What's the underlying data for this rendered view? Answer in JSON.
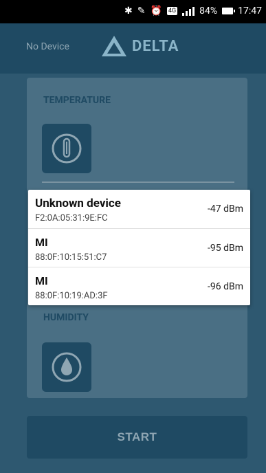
{
  "status_bar": {
    "battery": "84%",
    "time": "17:47",
    "network": "4G"
  },
  "header": {
    "device_status": "No Device",
    "brand": "DELTA"
  },
  "sections": {
    "temperature_title": "TEMPERATURE",
    "humidity_title": "HUMIDITY"
  },
  "start_label": "START",
  "devices": [
    {
      "name": "Unknown device",
      "mac": "F2:0A:05:31:9E:FC",
      "rssi": "-47 dBm"
    },
    {
      "name": "MI",
      "mac": "88:0F:10:15:51:C7",
      "rssi": "-95 dBm"
    },
    {
      "name": "MI",
      "mac": "88:0F:10:19:AD:3F",
      "rssi": "-96 dBm"
    }
  ],
  "colors": {
    "header_bg": "#1f4a63",
    "panel_bg": "#4a6f84",
    "accent": "#1f4a63"
  }
}
